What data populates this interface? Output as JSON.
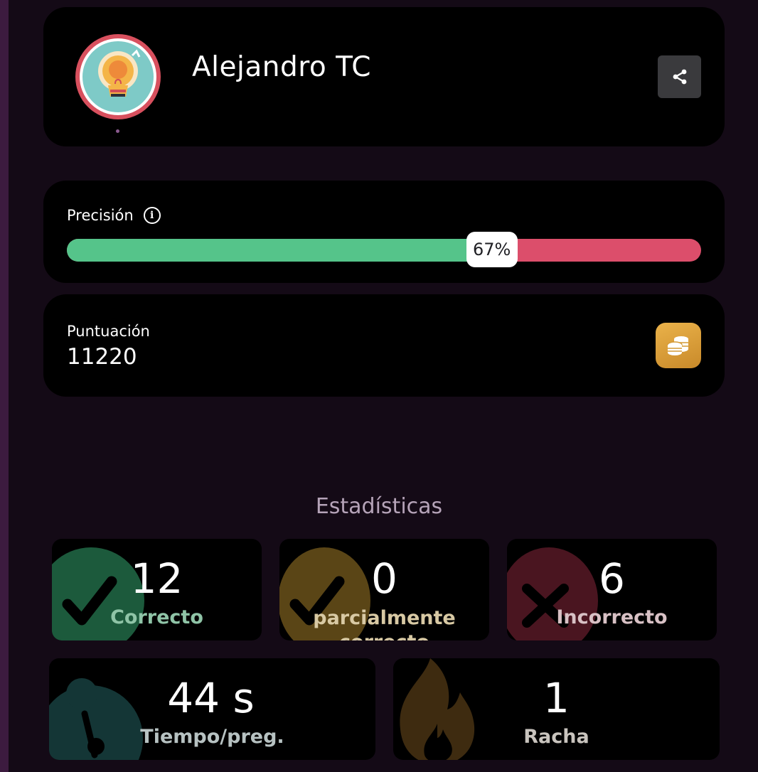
{
  "profile": {
    "name": "Alejandro TC"
  },
  "accuracy": {
    "label": "Precisión",
    "percent_text": "67%",
    "fraction": 0.67,
    "colors": {
      "correct": "#55c48a",
      "incorrect": "#dc4e6b"
    }
  },
  "score": {
    "label": "Puntuación",
    "value": "11220"
  },
  "stats": {
    "title": "Estadísticas",
    "correct": {
      "value": "12",
      "label": "Correcto",
      "color": "#1c5a3c"
    },
    "partial": {
      "value": "0",
      "label": "parcialmente correcto",
      "color": "#5a4516"
    },
    "incorrect": {
      "value": "6",
      "label": "Incorrecto",
      "color": "#4a1520"
    },
    "time": {
      "value": "44 s",
      "label": "Tiempo/preg.",
      "color": "#143636"
    },
    "streak": {
      "value": "1",
      "label": "Racha",
      "color": "#3e2b10"
    }
  }
}
